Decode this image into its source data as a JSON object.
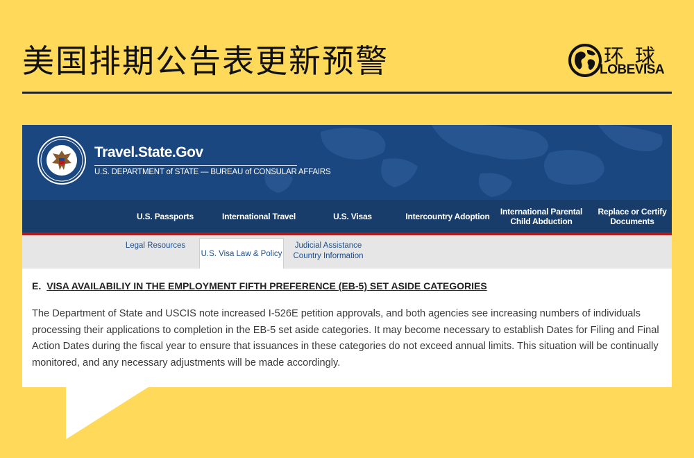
{
  "poster": {
    "title": "美国排期公告表更新预警"
  },
  "brand": {
    "name_cn": "环球",
    "name_en": "LOBEVISA",
    "globe_icon": "globe-icon"
  },
  "site": {
    "name": "Travel.State.Gov",
    "subtitle": "U.S. DEPARTMENT of STATE — BUREAU of CONSULAR AFFAIRS",
    "seal_icon": "department-seal-icon"
  },
  "nav": {
    "items": [
      {
        "label": "U.S. Passports"
      },
      {
        "label": "International Travel"
      },
      {
        "label": "U.S. Visas"
      },
      {
        "label": "Intercountry Adoption"
      },
      {
        "label": "International Parental\nChild Abduction"
      },
      {
        "label": "Replace or Certify\nDocuments"
      }
    ]
  },
  "subnav": {
    "items": [
      {
        "label": "Legal Resources"
      },
      {
        "label": "U.S. Visa Law & Policy"
      },
      {
        "label": "Judicial Assistance\nCountry Information"
      }
    ],
    "active": "U.S. Visa Law & Policy"
  },
  "content": {
    "section_letter": "E.",
    "section_title": "VISA AVAILABILIY IN THE EMPLOYMENT FIFTH PREFERENCE (EB-5) SET ASIDE CATEGORIES",
    "paragraph": "The Department of State and USCIS note increased I-526E petition approvals, and both agencies see increasing numbers of individuals processing their applications to completion in the EB-5 set aside categories.  It may become necessary to establish Dates for Filing and Final Action Dates during the fiscal year to ensure that issuances in these categories do not exceed annual limits.  This situation will be continually monitored, and any necessary adjustments will be made accordingly."
  },
  "colors": {
    "poster_background": "#ffd95a",
    "header_blue": "#1b4780",
    "nav_blue": "#183d6a",
    "accent_red": "#b31b1b",
    "link_blue": "#1d4f8f"
  }
}
